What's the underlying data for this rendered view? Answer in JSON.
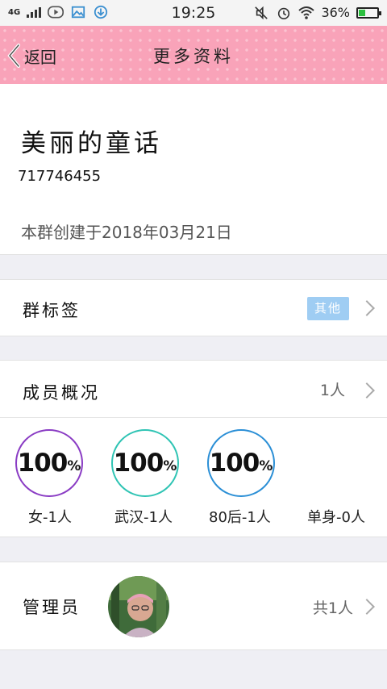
{
  "status_bar": {
    "network": "4G",
    "time": "19:25",
    "battery": "36%",
    "battery_level": 0.36
  },
  "nav": {
    "back_label": "返回",
    "title": "更多资料"
  },
  "group": {
    "name": "美丽的童话",
    "id": "717746455",
    "created": "本群创建于2018年03月21日"
  },
  "tags": {
    "label": "群标签",
    "value": "其他"
  },
  "members": {
    "label": "成员概况",
    "count": "1人",
    "stats": [
      {
        "value": "100",
        "unit": "%",
        "label": "女-1人",
        "color": "#8a3cc4"
      },
      {
        "value": "100",
        "unit": "%",
        "label": "武汉-1人",
        "color": "#2fc4b4"
      },
      {
        "value": "100",
        "unit": "%",
        "label": "80后-1人",
        "color": "#2b8fd6"
      }
    ],
    "extra_label": "单身-0人"
  },
  "admin": {
    "label": "管理员",
    "count": "共1人"
  },
  "colors": {
    "nav_bg": "#f9a3b9",
    "badge": "#9fcdf3",
    "battery": "#2bbf3f"
  }
}
